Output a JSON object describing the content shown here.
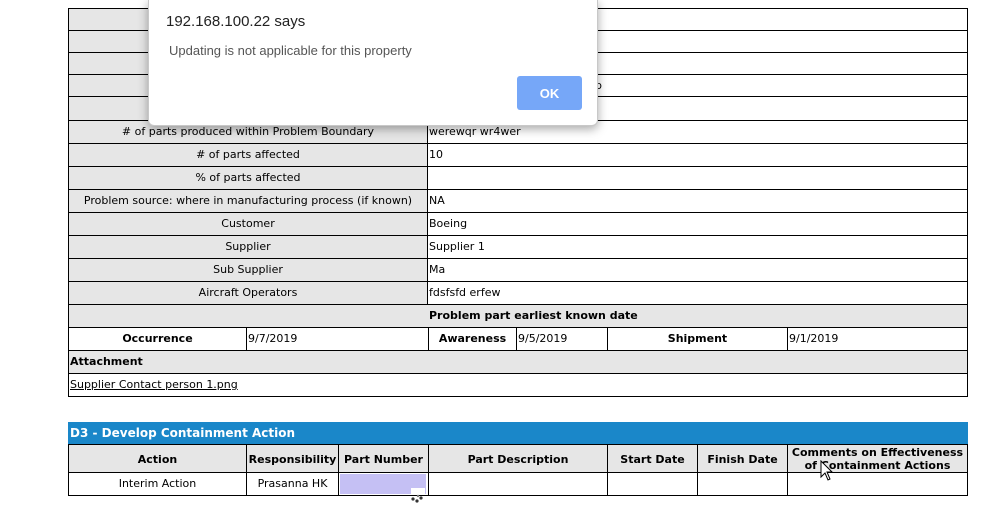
{
  "form": {
    "rows": [
      {
        "label": "# of parts produced within Problem Boundary",
        "value": "werewqr wr4wer"
      },
      {
        "label": "# of parts affected",
        "value": "10"
      },
      {
        "label": "% of parts affected",
        "value": ""
      },
      {
        "label": "Problem source: where in manufacturing process (if known)",
        "value": "NA"
      },
      {
        "label": "Customer",
        "value": "Boeing"
      },
      {
        "label": "Supplier",
        "value": "Supplier 1"
      },
      {
        "label": "Sub Supplier",
        "value": "Ma"
      },
      {
        "label": "Aircraft Operators",
        "value": "fdsfsfd erfew"
      }
    ],
    "hidden_value_fragment": "b",
    "earliest_header": "Problem part earliest known date",
    "occurrence_label": "Occurrence",
    "occurrence_value": "9/7/2019",
    "awareness_label": "Awareness",
    "awareness_value": "9/5/2019",
    "shipment_label": "Shipment",
    "shipment_value": "9/1/2019",
    "attachment_label": "Attachment",
    "attachment_file": "Supplier Contact person 1.png"
  },
  "d3": {
    "title": "D3 - Develop Containment Action",
    "columns": [
      "Action",
      "Responsibility",
      "Part Number",
      "Part Description",
      "Start Date",
      "Finish Date",
      "Comments on Effectiveness of Containment Actions"
    ],
    "row": {
      "action": "Interim Action",
      "responsibility": "Prasanna HK",
      "part_number": "",
      "part_description": "",
      "start_date": "",
      "finish_date": "",
      "comments": ""
    },
    "part_number_highlight": "#c5c0f4"
  },
  "dialog": {
    "title": "192.168.100.22 says",
    "message": "Updating is not applicable for this property",
    "ok_label": "OK"
  }
}
